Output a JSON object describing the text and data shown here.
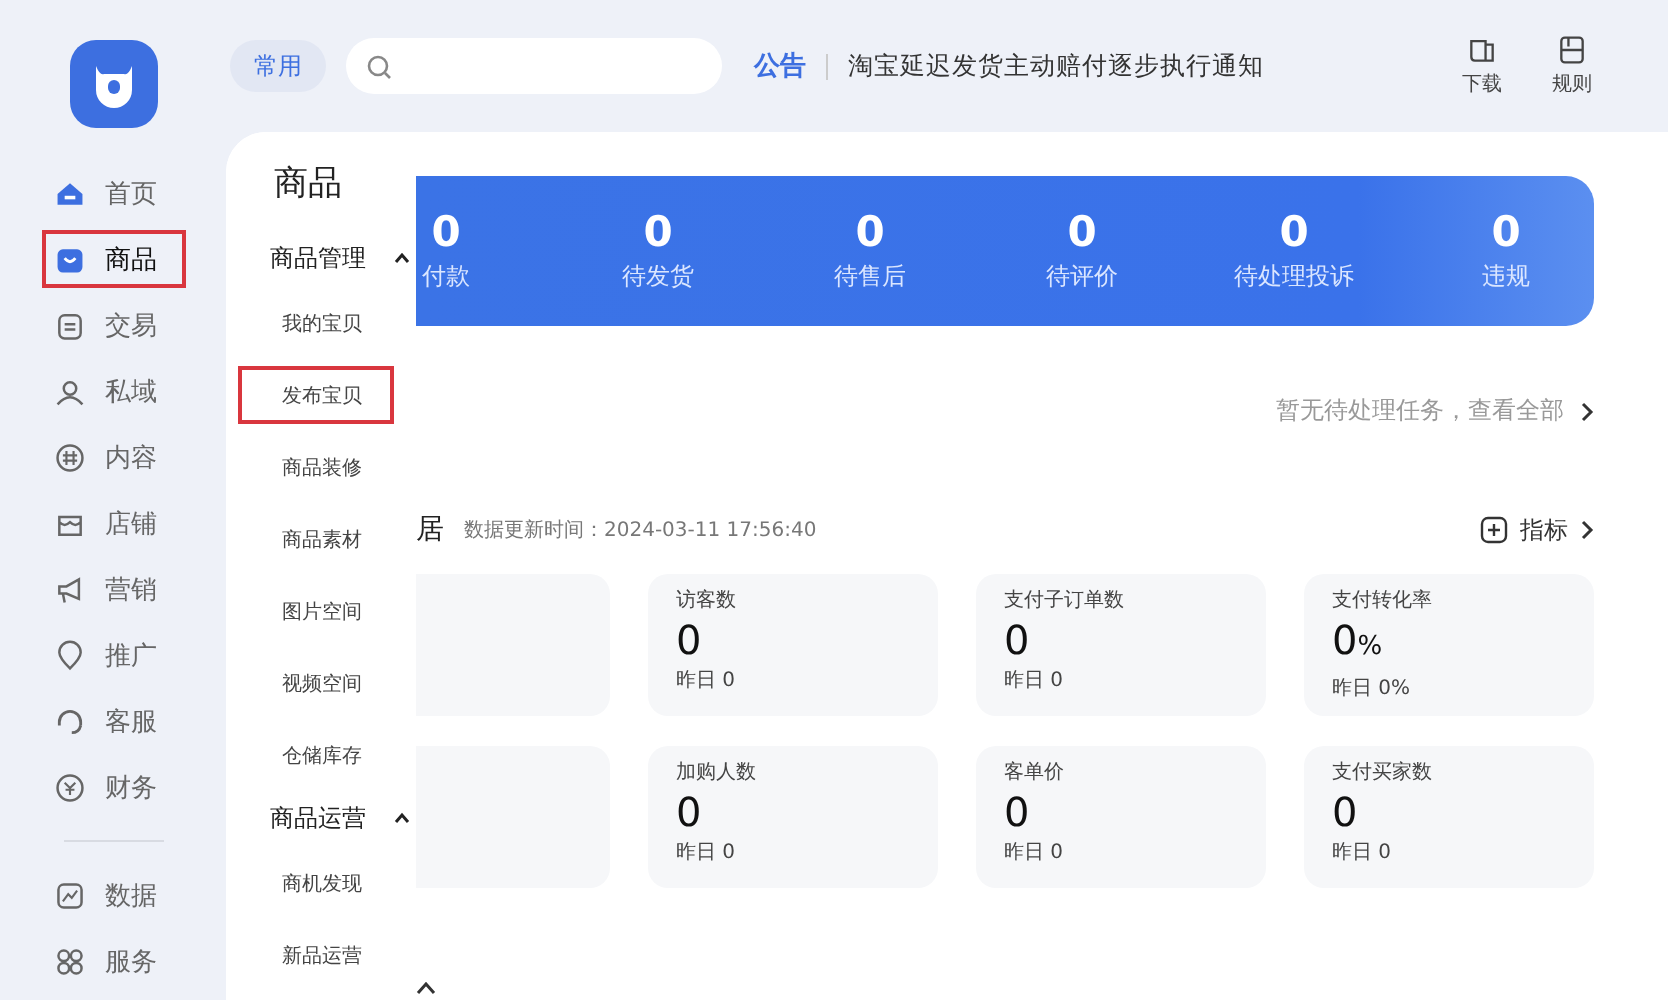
{
  "rail": {
    "items": [
      {
        "label": "首页",
        "kind": "home",
        "selected": false,
        "annotated": false
      },
      {
        "label": "商品",
        "kind": "bag",
        "selected": true,
        "annotated": true
      },
      {
        "label": "交易",
        "kind": "doc",
        "selected": false,
        "annotated": false
      },
      {
        "label": "私域",
        "kind": "people",
        "selected": false,
        "annotated": false
      },
      {
        "label": "内容",
        "kind": "hash",
        "selected": false,
        "annotated": false
      },
      {
        "label": "店铺",
        "kind": "store",
        "selected": false,
        "annotated": false
      },
      {
        "label": "营销",
        "kind": "horn",
        "selected": false,
        "annotated": false
      },
      {
        "label": "推广",
        "kind": "pin",
        "selected": false,
        "annotated": false
      },
      {
        "label": "客服",
        "kind": "headset",
        "selected": false,
        "annotated": false
      },
      {
        "label": "财务",
        "kind": "coin",
        "selected": false,
        "annotated": false
      }
    ],
    "bottom_items": [
      {
        "label": "数据",
        "kind": "chart",
        "selected": false,
        "annotated": false
      },
      {
        "label": "服务",
        "kind": "grid",
        "selected": false,
        "annotated": false
      }
    ]
  },
  "topbar": {
    "quick_button": "常用",
    "notice_label": "公告",
    "notice": "淘宝延迟发货主动赔付逐步执行通知",
    "tools": [
      {
        "label": "下载",
        "kind": "download"
      },
      {
        "label": "规则",
        "kind": "book"
      }
    ]
  },
  "flyout": {
    "title": "商品",
    "groups": [
      {
        "title": "商品管理",
        "expanded": true,
        "items": [
          {
            "label": "我的宝贝",
            "annotated": false
          },
          {
            "label": "发布宝贝",
            "annotated": true
          },
          {
            "label": "商品装修",
            "annotated": false
          },
          {
            "label": "商品素材",
            "annotated": false
          },
          {
            "label": "图片空间",
            "annotated": false
          },
          {
            "label": "视频空间",
            "annotated": false
          },
          {
            "label": "仓储库存",
            "annotated": false
          }
        ]
      },
      {
        "title": "商品运营",
        "expanded": true,
        "items": [
          {
            "label": "商机发现",
            "annotated": false
          },
          {
            "label": "新品运营",
            "annotated": false
          }
        ]
      }
    ]
  },
  "banner": {
    "stats": [
      {
        "value": "0",
        "label": "付款"
      },
      {
        "value": "0",
        "label": "待发货"
      },
      {
        "value": "0",
        "label": "待售后"
      },
      {
        "value": "0",
        "label": "待评价"
      },
      {
        "value": "0",
        "label": "待处理投诉"
      },
      {
        "value": "0",
        "label": "违规"
      }
    ]
  },
  "todo_link": "暂无待处理任务，查看全部",
  "data_section": {
    "title": "居",
    "update_time": "数据更新时间：2024-03-11 17:56:40",
    "metrics_button": "指标",
    "cards": [
      {
        "kind": "partial"
      },
      {
        "kind": "metric",
        "label": "访客数",
        "value": "0",
        "compare": "昨日 0"
      },
      {
        "kind": "metric",
        "label": "支付子订单数",
        "value": "0",
        "compare": "昨日 0"
      },
      {
        "kind": "metric",
        "label": "支付转化率",
        "value": "0",
        "unit": "%",
        "compare": "昨日 0%"
      },
      {
        "kind": "partial"
      },
      {
        "kind": "metric",
        "label": "加购人数",
        "value": "0",
        "compare": "昨日 0"
      },
      {
        "kind": "metric",
        "label": "客单价",
        "value": "0",
        "compare": "昨日 0"
      },
      {
        "kind": "metric",
        "label": "支付买家数",
        "value": "0",
        "compare": "昨日 0"
      }
    ]
  }
}
